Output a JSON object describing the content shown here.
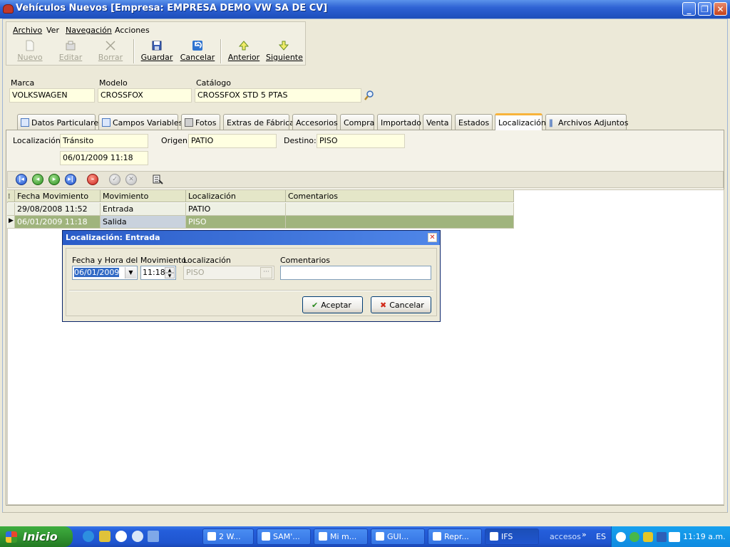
{
  "window": {
    "title": "Vehículos Nuevos [Empresa: EMPRESA DEMO VW SA DE CV]",
    "minimize": "_",
    "restore": "❐",
    "close": "✕"
  },
  "menu": {
    "items": [
      "Archivo",
      "Ver",
      "Navegación",
      "Acciones"
    ]
  },
  "toolbar": {
    "nuevo": "Nuevo",
    "editar": "Editar",
    "borrar": "Borrar",
    "guardar": "Guardar",
    "cancelar": "Cancelar",
    "anterior": "Anterior",
    "siguiente": "Siguiente"
  },
  "vehicle": {
    "marca_label": "Marca",
    "marca_value": "VOLKSWAGEN",
    "modelo_label": "Modelo",
    "modelo_value": "CROSSFOX",
    "catalogo_label": "Catálogo",
    "catalogo_value": "CROSSFOX  STD 5 PTAS"
  },
  "tabs": [
    "Datos Particulares",
    "Campos Variables",
    "Fotos",
    "Extras de Fábrica",
    "Accesorios",
    "Compra",
    "Importado",
    "Venta",
    "Estados",
    "Localización",
    "Archivos Adjuntos"
  ],
  "localizacion": {
    "loc_label": "Localización:",
    "loc_value": "Tránsito",
    "date_value": "06/01/2009 11:18",
    "origen_label": "Origen:",
    "origen_value": "PATIO",
    "destino_label": "Destino:",
    "destino_value": "PISO"
  },
  "grid": {
    "columns": [
      "Fecha Movimiento",
      "Movimiento",
      "Localización",
      "Comentarios"
    ],
    "rows": [
      [
        "29/08/2008 11:52",
        "Entrada",
        "PATIO",
        ""
      ],
      [
        "06/01/2009 11:18",
        "Salida",
        "PISO",
        ""
      ]
    ]
  },
  "dialog": {
    "title": "Localización: Entrada",
    "fecha_label": "Fecha y Hora del Movimiento",
    "fecha_value": "06/01/2009",
    "hora_value": "11:18",
    "loc_label": "Localización",
    "loc_value": "PISO",
    "ellipsis": "···",
    "comentarios_label": "Comentarios",
    "comentarios_value": "",
    "aceptar": "Aceptar",
    "cancelar": "Cancelar"
  },
  "taskbar": {
    "start": "Inicio",
    "tasks": [
      "2 W...",
      "SAM'...",
      "Mi m...",
      "GUI...",
      "Repr...",
      "IFS"
    ],
    "accesos": "accesos",
    "lang": "ES",
    "clock": "11:19 a.m."
  },
  "colors": {
    "titlebar": "#2457c8",
    "field_bg": "#ffffe1",
    "grid_header": "#e4e6c8",
    "selected_row": "#a0b47d",
    "tab_active_accent": "#f8b33b"
  }
}
